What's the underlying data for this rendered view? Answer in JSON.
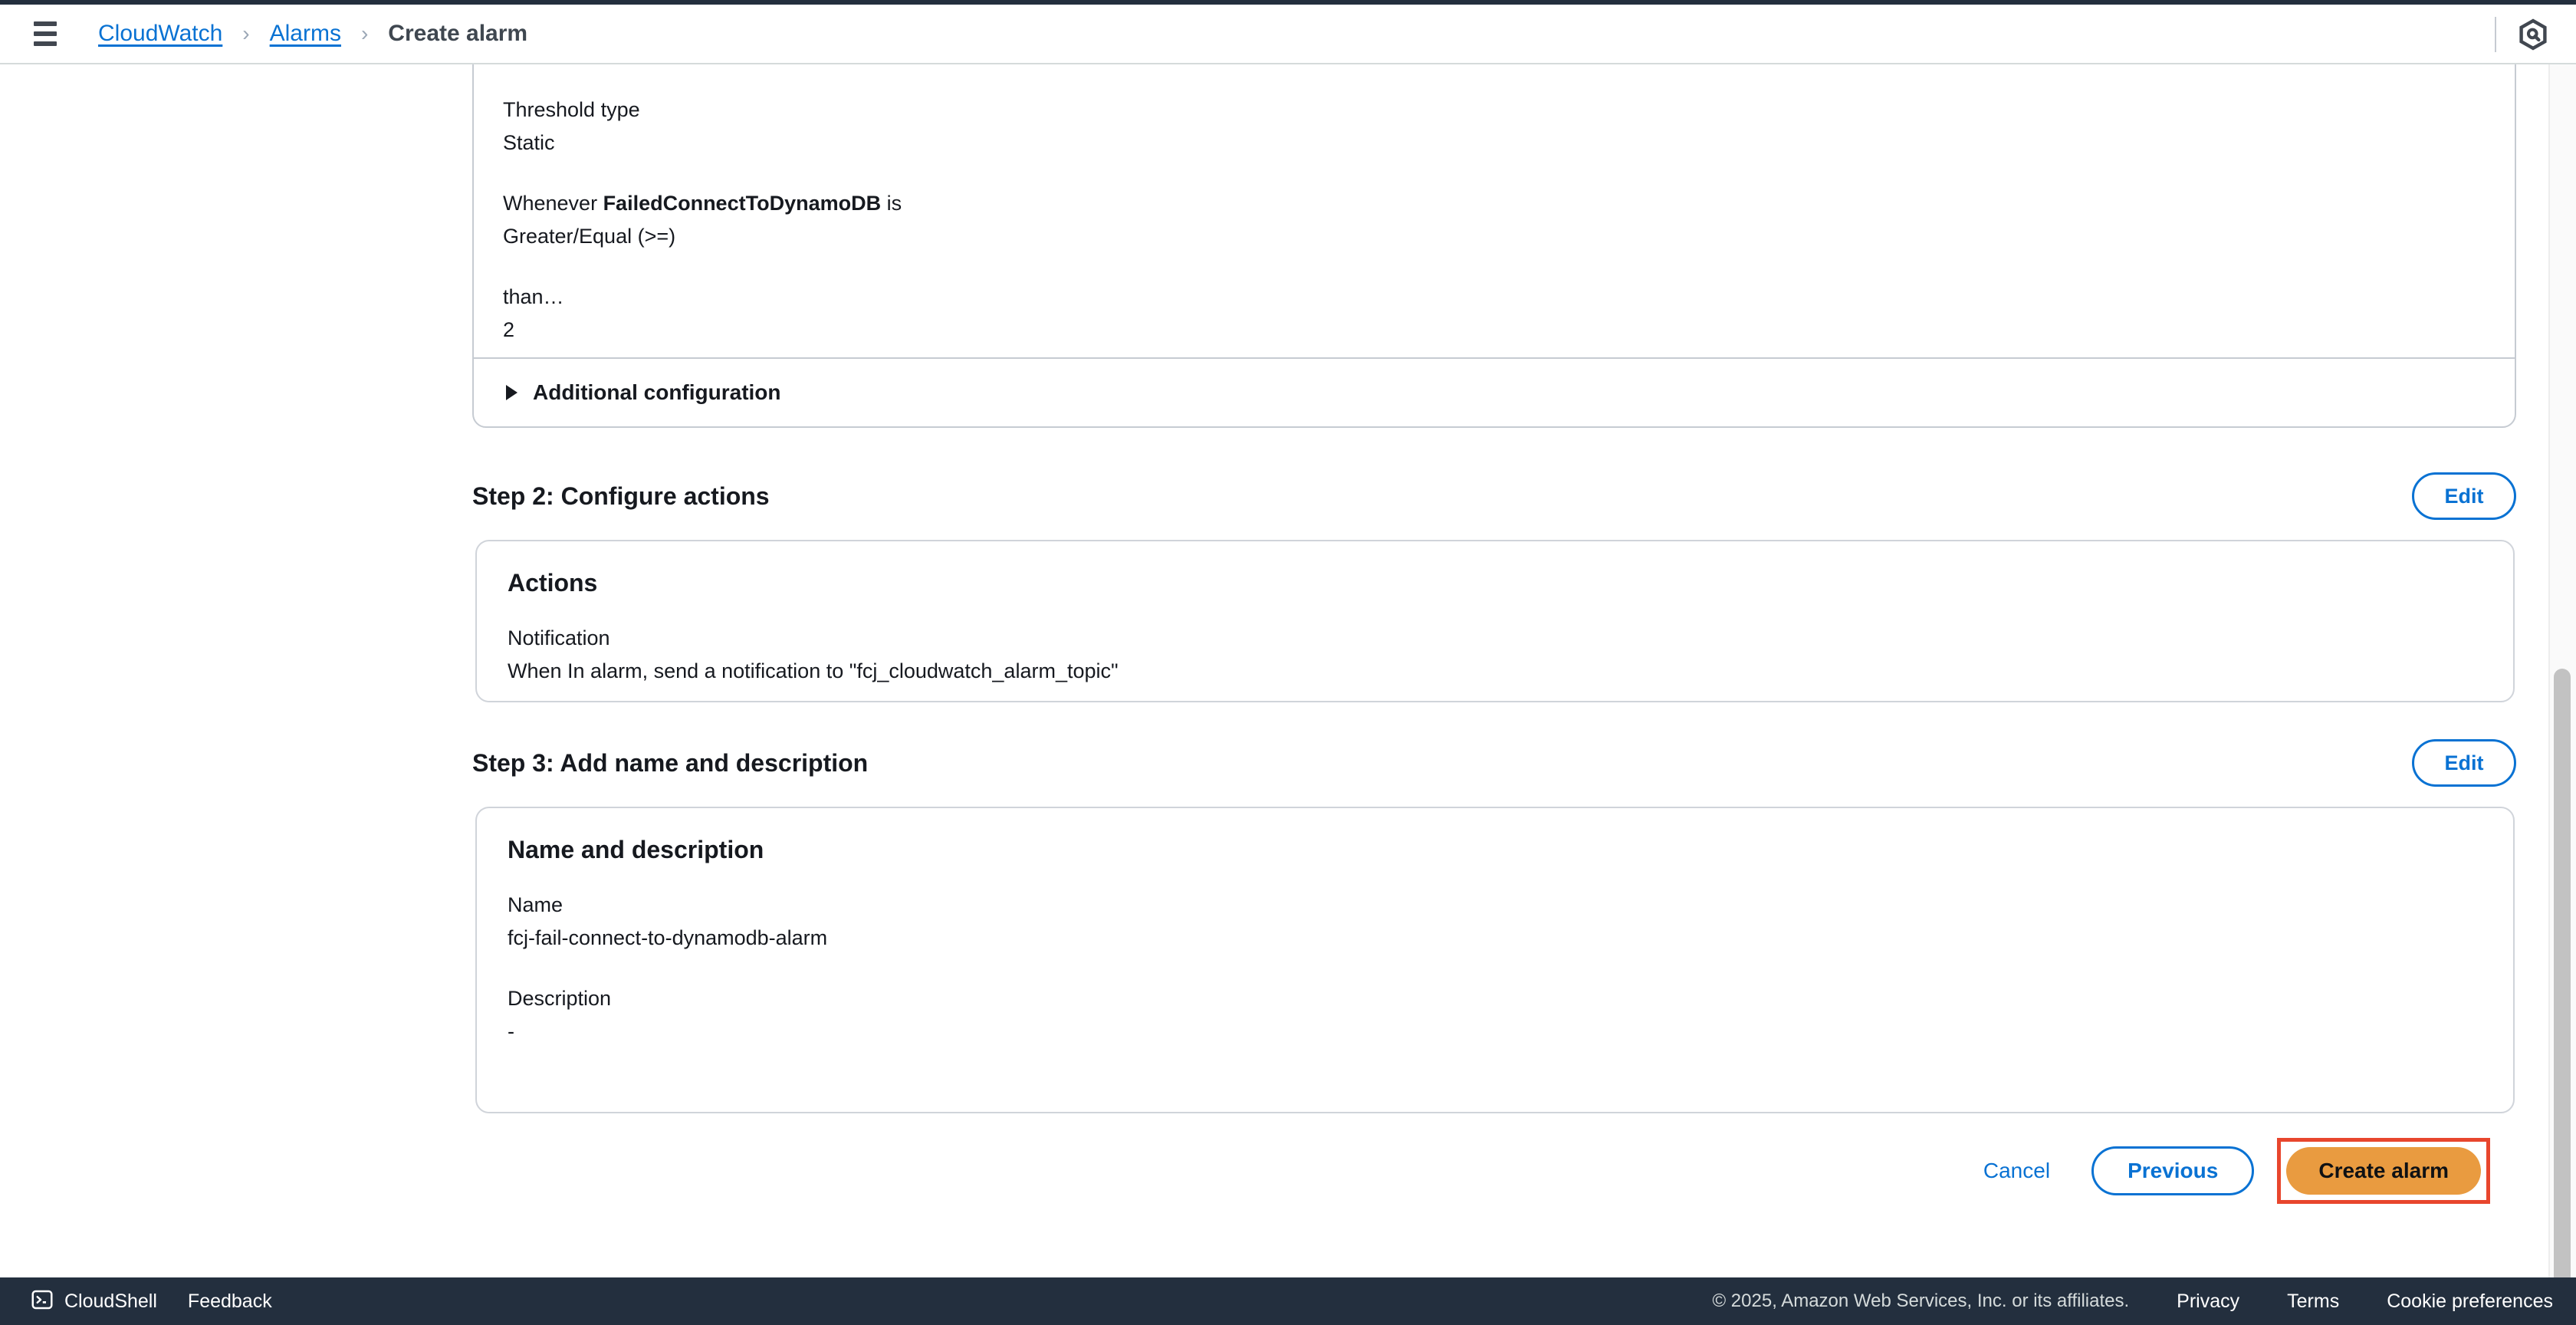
{
  "header": {
    "menu_icon": "hamburger-menu-icon",
    "breadcrumb": {
      "items": [
        {
          "label": "CloudWatch",
          "type": "link"
        },
        {
          "label": "Alarms",
          "type": "link"
        },
        {
          "label": "Create alarm",
          "type": "current"
        }
      ],
      "separator": "›"
    },
    "assistant_icon": "amazon-q-hexagon-icon"
  },
  "step1_tail": {
    "threshold_type_label": "Threshold type",
    "threshold_type_value": "Static",
    "condition_prefix": "Whenever ",
    "condition_metric": "FailedConnectToDynamoDB",
    "condition_suffix": " is",
    "condition_operator": "Greater/Equal (>=)",
    "than_label": "than…",
    "than_value": "2",
    "additional_configuration_label": "Additional configuration",
    "additional_configuration_caret": "caret-right-icon"
  },
  "step2": {
    "heading": "Step 2: Configure actions",
    "edit_label": "Edit",
    "card_title": "Actions",
    "notification_label": "Notification",
    "notification_value": "When In alarm, send a notification to \"fcj_cloudwatch_alarm_topic\""
  },
  "step3": {
    "heading": "Step 3: Add name and description",
    "edit_label": "Edit",
    "card_title": "Name and description",
    "name_label": "Name",
    "name_value": "fcj-fail-connect-to-dynamodb-alarm",
    "description_label": "Description",
    "description_value": "-"
  },
  "form_actions": {
    "cancel_label": "Cancel",
    "previous_label": "Previous",
    "create_label": "Create alarm",
    "highlight_color": "#e8462d",
    "create_button_color": "#e99b40"
  },
  "footer": {
    "cloudshell_label": "CloudShell",
    "cloudshell_icon": "terminal-prompt-icon",
    "feedback_label": "Feedback",
    "copyright": "© 2025, Amazon Web Services, Inc. or its affiliates.",
    "privacy_label": "Privacy",
    "terms_label": "Terms",
    "cookie_label": "Cookie preferences"
  },
  "colors": {
    "link_blue": "#0972d3",
    "header_dark": "#232f3e",
    "text_primary": "#16191f"
  }
}
